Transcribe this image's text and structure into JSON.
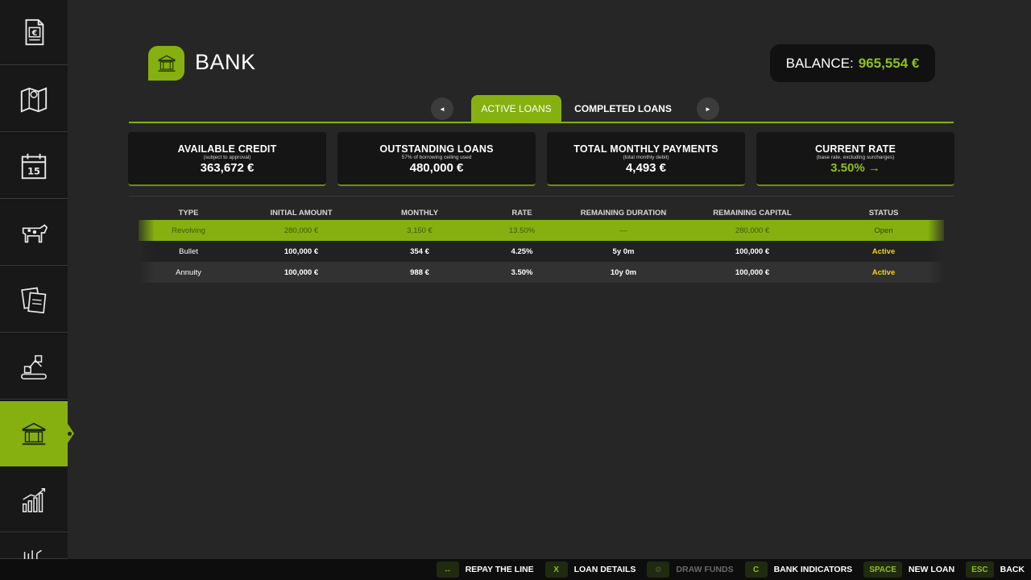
{
  "sidebar": {
    "items": [
      {
        "icon": "finance-document-icon"
      },
      {
        "icon": "map-icon"
      },
      {
        "icon": "calendar-icon",
        "day": "15"
      },
      {
        "icon": "cow-icon"
      },
      {
        "icon": "contracts-icon"
      },
      {
        "icon": "production-icon"
      },
      {
        "icon": "bank-icon",
        "active": true
      },
      {
        "icon": "statistics-icon"
      },
      {
        "icon": "more-icon"
      }
    ]
  },
  "header": {
    "title": "BANK",
    "balance_label": "BALANCE:",
    "balance_value": "965,554 €"
  },
  "tabs": {
    "prev": "◄",
    "next": "►",
    "items": [
      {
        "label": "ACTIVE LOANS",
        "active": true
      },
      {
        "label": "COMPLETED LOANS",
        "active": false
      }
    ]
  },
  "cards": [
    {
      "title": "AVAILABLE CREDIT",
      "sub": "(subject to approval)",
      "value": "363,672 €"
    },
    {
      "title": "OUTSTANDING LOANS",
      "sub": "57% of borrowing ceiling used",
      "value": "480,000 €"
    },
    {
      "title": "TOTAL MONTHLY PAYMENTS",
      "sub": "(total monthly debit)",
      "value": "4,493 €"
    },
    {
      "title": "CURRENT RATE",
      "sub": "(base rate, excluding surcharges)",
      "value": "3.50% →"
    }
  ],
  "table": {
    "headers": [
      "TYPE",
      "INITIAL AMOUNT",
      "MONTHLY",
      "RATE",
      "REMAINING DURATION",
      "REMAINING CAPITAL",
      "STATUS"
    ],
    "rows": [
      [
        "Revolving",
        "280,000 €",
        "3,150 €",
        "13.50%",
        "—",
        "280,000 €",
        "Open"
      ],
      [
        "Bullet",
        "100,000 €",
        "354 €",
        "4.25%",
        "5y 0m",
        "100,000 €",
        "Active"
      ],
      [
        "Annuity",
        "100,000 €",
        "988 €",
        "3.50%",
        "10y 0m",
        "100,000 €",
        "Active"
      ]
    ]
  },
  "bottombar": {
    "hints": [
      {
        "key": "↔",
        "label": "REPAY THE LINE",
        "enabled": true
      },
      {
        "key": "X",
        "label": "LOAN DETAILS",
        "enabled": true
      },
      {
        "key": "⊘",
        "label": "DRAW FUNDS",
        "enabled": false
      },
      {
        "key": "C",
        "label": "BANK INDICATORS",
        "enabled": true
      },
      {
        "key": "SPACE",
        "label": "NEW LOAN",
        "enabled": true
      },
      {
        "key": "ESC",
        "label": "BACK",
        "enabled": true
      }
    ]
  },
  "colors": {
    "accent": "#86b010",
    "accent_text": "#8fc11a",
    "status_active": "#f2d11c",
    "background": "#262626"
  }
}
